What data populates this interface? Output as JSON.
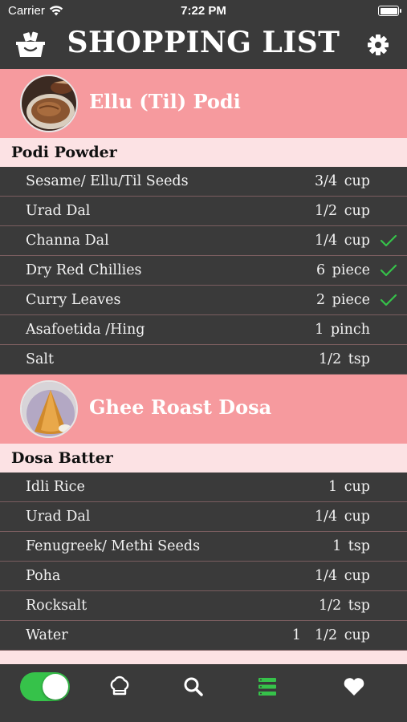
{
  "status_bar": {
    "carrier": "Carrier",
    "time": "7:22 PM"
  },
  "header": {
    "title": "SHOPPING LIST",
    "left_icon": "basket-icon",
    "right_icon": "gear-icon"
  },
  "recipes": [
    {
      "name": "Ellu (Til) Podi",
      "section": "Podi Powder",
      "items": [
        {
          "name": "Sesame/ Ellu/Til Seeds",
          "qty": "3/4 cup",
          "checked": false
        },
        {
          "name": "Urad Dal",
          "qty": "1/2 cup",
          "checked": false
        },
        {
          "name": "Channa Dal",
          "qty": "1/4 cup",
          "checked": true
        },
        {
          "name": "Dry Red Chillies",
          "qty": "6 piece",
          "checked": true
        },
        {
          "name": "Curry Leaves",
          "qty": "2 piece",
          "checked": true
        },
        {
          "name": "Asafoetida /Hing",
          "qty": "1 pinch",
          "checked": false
        },
        {
          "name": "Salt",
          "qty": "1/2 tsp",
          "checked": false
        }
      ]
    },
    {
      "name": "Ghee Roast Dosa",
      "section": "Dosa Batter",
      "items": [
        {
          "name": "Idli Rice",
          "qty": "1 cup",
          "checked": false
        },
        {
          "name": "Urad Dal",
          "qty": "1/4 cup",
          "checked": false
        },
        {
          "name": "Fenugreek/ Methi Seeds",
          "qty": "1 tsp",
          "checked": false
        },
        {
          "name": "Poha",
          "qty": "1/4 cup",
          "checked": false
        },
        {
          "name": "Rocksalt",
          "qty": "1/2 tsp",
          "checked": false
        },
        {
          "name": "Water",
          "qty": "1  1/2 cup",
          "checked": false
        }
      ]
    }
  ],
  "tab_bar": {
    "toggle_on": true,
    "tabs": [
      "chef-hat-icon",
      "search-icon",
      "list-icon",
      "heart-icon"
    ],
    "active_tab": "list-icon"
  },
  "colors": {
    "background": "#3a3a3a",
    "recipe_header": "#f69a9e",
    "section_header": "#fce2e4",
    "check": "#36c24a",
    "active_tab": "#36c24a"
  }
}
